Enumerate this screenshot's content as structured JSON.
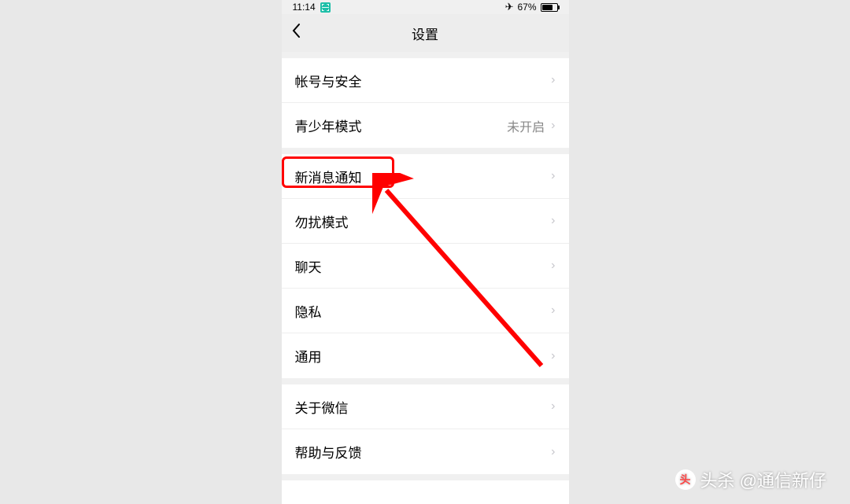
{
  "statusBar": {
    "time": "11:14",
    "batteryPercent": "67%"
  },
  "nav": {
    "title": "设置"
  },
  "sections": [
    {
      "rows": [
        {
          "label": "帐号与安全",
          "value": ""
        },
        {
          "label": "青少年模式",
          "value": "未开启"
        }
      ]
    },
    {
      "rows": [
        {
          "label": "新消息通知",
          "value": ""
        },
        {
          "label": "勿扰模式",
          "value": ""
        },
        {
          "label": "聊天",
          "value": ""
        },
        {
          "label": "隐私",
          "value": ""
        },
        {
          "label": "通用",
          "value": ""
        }
      ]
    },
    {
      "rows": [
        {
          "label": "关于微信",
          "value": ""
        },
        {
          "label": "帮助与反馈",
          "value": ""
        }
      ]
    }
  ],
  "watermark": {
    "text": "头杀 @通信新仔"
  },
  "annotation": {
    "highlightedItem": "新消息通知"
  }
}
